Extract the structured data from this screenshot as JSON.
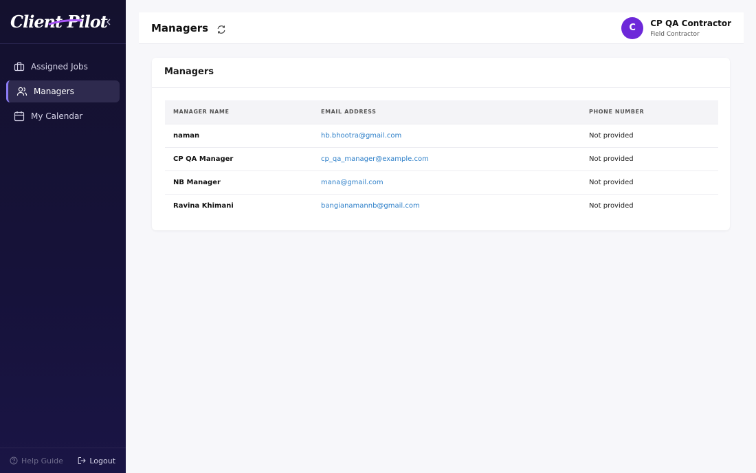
{
  "brand": {
    "logo_text": "Client Pilot"
  },
  "sidebar": {
    "items": [
      {
        "label": "Assigned Jobs",
        "icon": "briefcase-icon"
      },
      {
        "label": "Managers",
        "icon": "users-icon",
        "active": true
      },
      {
        "label": "My Calendar",
        "icon": "calendar-icon"
      }
    ],
    "footer": {
      "help_label": "Help Guide",
      "logout_label": "Logout"
    }
  },
  "header": {
    "title": "Managers",
    "user": {
      "initial": "C",
      "name": "CP QA Contractor",
      "role": "Field Contractor"
    }
  },
  "card": {
    "title": "Managers",
    "columns": [
      "MANAGER NAME",
      "EMAIL ADDRESS",
      "PHONE NUMBER"
    ],
    "rows": [
      {
        "name": "naman",
        "email": "hb.bhootra@gmail.com",
        "phone": "Not provided"
      },
      {
        "name": "CP QA Manager",
        "email": "cp_qa_manager@example.com",
        "phone": "Not provided"
      },
      {
        "name": "NB Manager",
        "email": "mana@gmail.com",
        "phone": "Not provided"
      },
      {
        "name": "Ravina Khimani",
        "email": "bangianamannb@gmail.com",
        "phone": "Not provided"
      }
    ]
  },
  "colors": {
    "accent": "#6d28d9",
    "link": "#2f80c9",
    "sidebar_bg": "#14112e"
  }
}
